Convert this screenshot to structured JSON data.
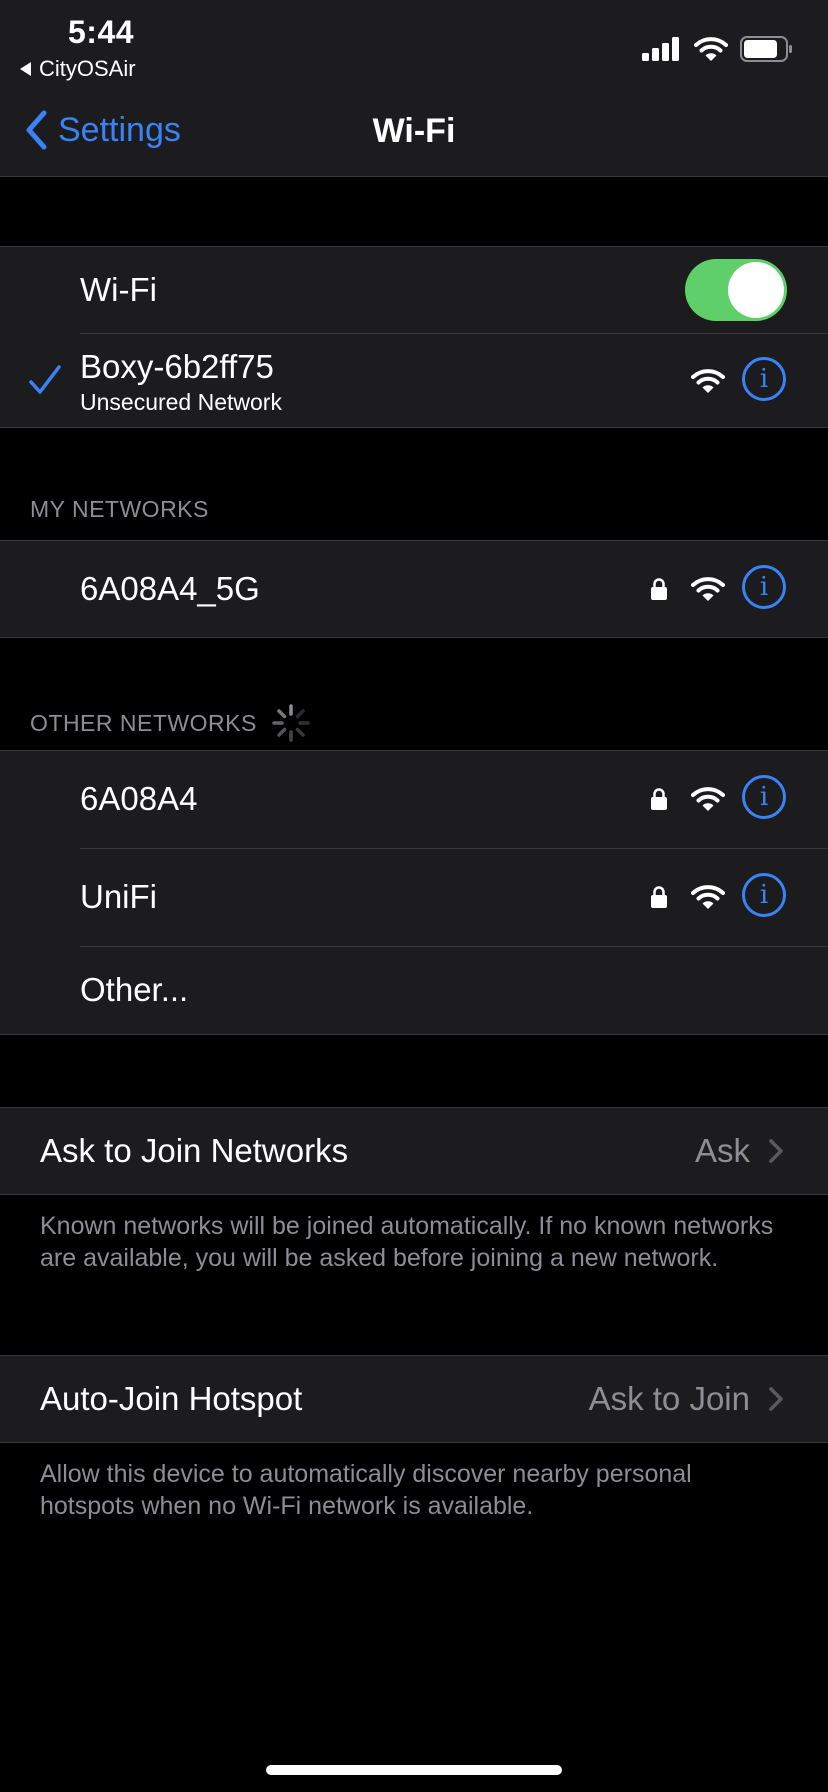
{
  "status_bar": {
    "time": "5:44",
    "back_app": "CityOSAir"
  },
  "nav": {
    "back_label": "Settings",
    "title": "Wi-Fi"
  },
  "wifi": {
    "toggle_label": "Wi-Fi",
    "toggle_on": true,
    "connected_name": "Boxy-6b2ff75",
    "connected_subtitle": "Unsecured Network"
  },
  "my_networks": {
    "header": "MY NETWORKS",
    "items": [
      {
        "name": "6A08A4_5G",
        "locked": true
      }
    ]
  },
  "other_networks": {
    "header": "OTHER NETWORKS",
    "items": [
      {
        "name": "6A08A4",
        "locked": true
      },
      {
        "name": "UniFi",
        "locked": true
      }
    ],
    "other_label": "Other..."
  },
  "ask_to_join": {
    "label": "Ask to Join Networks",
    "value": "Ask",
    "footer": "Known networks will be joined automatically. If no known networks are available, you will be asked before joining a new network."
  },
  "auto_join": {
    "label": "Auto-Join Hotspot",
    "value": "Ask to Join",
    "footer": "Allow this device to automatically discover nearby personal hotspots when no Wi-Fi network is available."
  },
  "colors": {
    "accent": "#3a82f7",
    "toggle_on": "#5fd069",
    "cell_bg": "#1c1c1e",
    "secondary_text": "#8d8d93"
  }
}
